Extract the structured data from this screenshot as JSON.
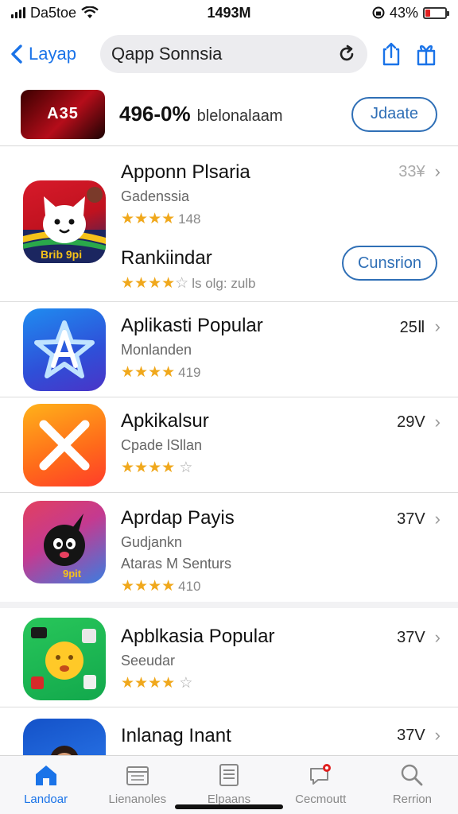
{
  "status_bar": {
    "carrier": "Da5toe",
    "time": "1493M",
    "battery_percent": "43%",
    "battery_level": 0.25
  },
  "nav": {
    "back_label": "Layap",
    "search_text": "Qapp Sonnsia"
  },
  "promo": {
    "thumb_text": "A35",
    "big_text": "496-0%",
    "small_text": "blelonalaam",
    "button_label": "Jdaate"
  },
  "apps": [
    {
      "title": "Apponn Plsaria",
      "subtitle": "Gadenssia",
      "stars": 4,
      "rating_text": "148",
      "right_value": "33¥",
      "second_title": "Rankiindar",
      "second_rating_text": "ls olg: zulb",
      "second_stars": 4,
      "action_label": "Cunsrion"
    },
    {
      "title": "Aplikasti Popular",
      "subtitle": "Monlanden",
      "stars": 4,
      "rating_text": "419",
      "right_value": "25Ⅱ"
    },
    {
      "title": "Apkikalsur",
      "subtitle": "Cpade lSllan",
      "stars": 4,
      "rating_text": "",
      "right_value": "29V"
    },
    {
      "title": "Aprdap Payis",
      "subtitle": "Gudjankn",
      "subtitle2": "Ataras M Senturs",
      "stars": 4,
      "rating_text": "410",
      "right_value": "37V"
    },
    {
      "title": "Apblkasia Popular",
      "subtitle": "Seeudar",
      "stars": 4,
      "rating_text": "",
      "right_value": "37V"
    },
    {
      "title": "Inlanag Inant",
      "subtitle": "",
      "right_value": "37V"
    }
  ],
  "tabs": [
    {
      "label": "Landoar",
      "icon": "home-icon",
      "active": true
    },
    {
      "label": "Lienanoles",
      "icon": "folder-icon",
      "active": false
    },
    {
      "label": "Elpaans",
      "icon": "list-icon",
      "active": false
    },
    {
      "label": "Cecmoutt",
      "icon": "chat-icon",
      "active": false
    },
    {
      "label": "Rerrion",
      "icon": "search-icon",
      "active": false
    }
  ],
  "colors": {
    "accent": "#1a73e8",
    "star": "#f0a81c",
    "battery_low": "#e02020"
  }
}
